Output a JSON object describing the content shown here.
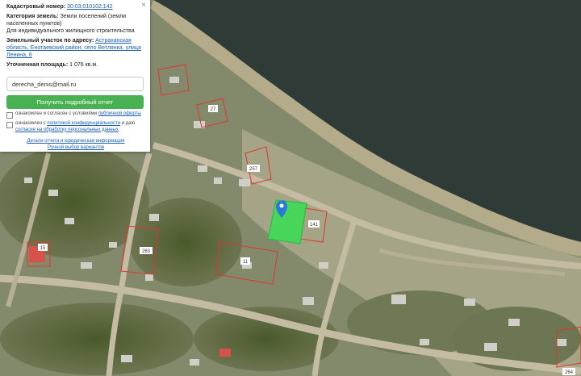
{
  "panel": {
    "close": "×",
    "cadastral": {
      "label": "Кадастровый номер:",
      "value": "30:03:010102:142"
    },
    "category": {
      "label": "Категория земель:",
      "value": "Земли поселений (земли населенных пунктов)",
      "use": "Для индивидуального жилищного строительства"
    },
    "address": {
      "label": "Земельный участок по адресу:",
      "value": "Астраханская область, Енотаевский район, село Ветлянка, улица Ленина, 6"
    },
    "area": {
      "label": "Уточненная площадь:",
      "value": "1 076 кв.м."
    },
    "email": "derecha_denis@mail.ru",
    "button": "Получить подробный отчет",
    "consent1": {
      "text": "ознакомлен и согласен с условиями",
      "link": "публичной оферты"
    },
    "consent2": {
      "text": "ознакомлен с",
      "link1": "политикой конфиденциальности",
      "mid": "и даю",
      "link2": "согласие на обработку персональных данных"
    },
    "details_link": "Детали отчета и юридическая информация",
    "manual_link": "Ручной выбор вариантов"
  },
  "lots": [
    "257",
    "141",
    "11",
    "263",
    "15",
    "27",
    "264"
  ],
  "colors": {
    "plot": "#3ddc55",
    "boundary": "#e2362b",
    "button": "#48b253",
    "link": "#1a5fb4",
    "water": "#2f3b36"
  }
}
